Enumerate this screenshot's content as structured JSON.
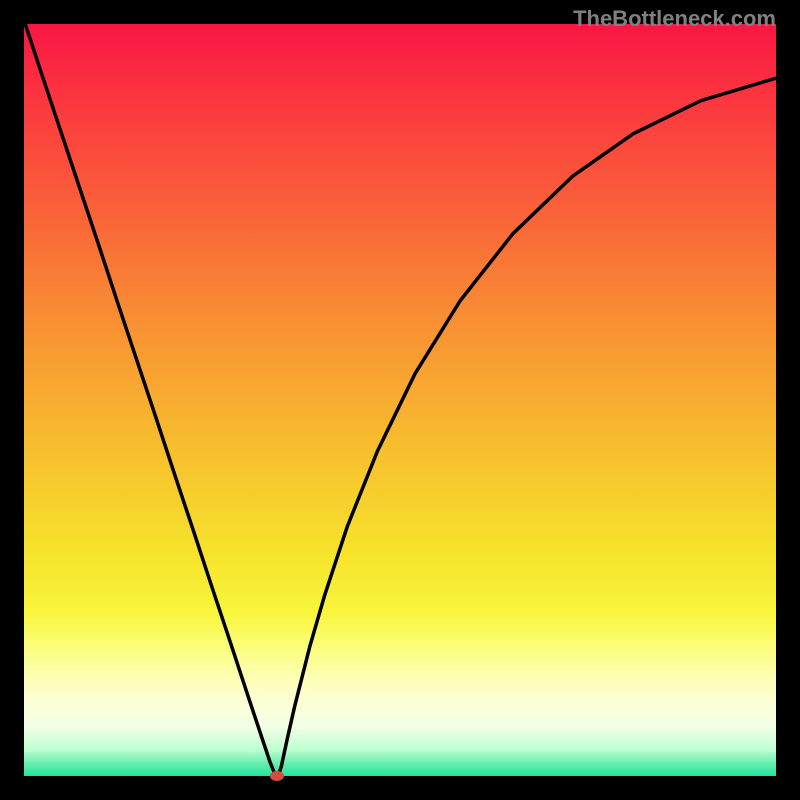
{
  "watermark": "TheBottleneck.com",
  "chart_data": {
    "type": "line",
    "title": "",
    "xlabel": "",
    "ylabel": "",
    "xlim": [
      0,
      1
    ],
    "ylim": [
      0,
      1
    ],
    "background_gradient": {
      "stops": [
        {
          "offset": 0.0,
          "color": "#fa1643"
        },
        {
          "offset": 0.12,
          "color": "#fb3c3e"
        },
        {
          "offset": 0.25,
          "color": "#fa6239"
        },
        {
          "offset": 0.4,
          "color": "#f89133"
        },
        {
          "offset": 0.55,
          "color": "#f7ba2e"
        },
        {
          "offset": 0.7,
          "color": "#f6e22b"
        },
        {
          "offset": 0.78,
          "color": "#f8f53a"
        },
        {
          "offset": 0.82,
          "color": "#fbfd6e"
        },
        {
          "offset": 0.86,
          "color": "#fdffa9"
        },
        {
          "offset": 0.9,
          "color": "#fdffd4"
        },
        {
          "offset": 0.935,
          "color": "#f1ffe6"
        },
        {
          "offset": 0.965,
          "color": "#bdffd0"
        },
        {
          "offset": 0.985,
          "color": "#5eecae"
        },
        {
          "offset": 1.0,
          "color": "#20e69e"
        }
      ]
    },
    "series": [
      {
        "name": "bottleneck-curve",
        "color": "#000000",
        "x": [
          0.0,
          0.025,
          0.05,
          0.075,
          0.1,
          0.125,
          0.15,
          0.175,
          0.2,
          0.225,
          0.25,
          0.275,
          0.3,
          0.315,
          0.327,
          0.333,
          0.336,
          0.339,
          0.342,
          0.345,
          0.35,
          0.36,
          0.38,
          0.4,
          0.43,
          0.47,
          0.52,
          0.58,
          0.65,
          0.73,
          0.81,
          0.9,
          1.0
        ],
        "y": [
          1.005,
          0.929,
          0.854,
          0.779,
          0.704,
          0.628,
          0.553,
          0.478,
          0.402,
          0.327,
          0.251,
          0.176,
          0.1,
          0.055,
          0.019,
          0.004,
          0.0,
          0.003,
          0.012,
          0.026,
          0.049,
          0.093,
          0.172,
          0.241,
          0.332,
          0.432,
          0.535,
          0.632,
          0.721,
          0.798,
          0.854,
          0.898,
          0.928
        ]
      }
    ],
    "marker": {
      "x": 0.336,
      "y": 0.0,
      "color": "#d84a3e"
    }
  }
}
